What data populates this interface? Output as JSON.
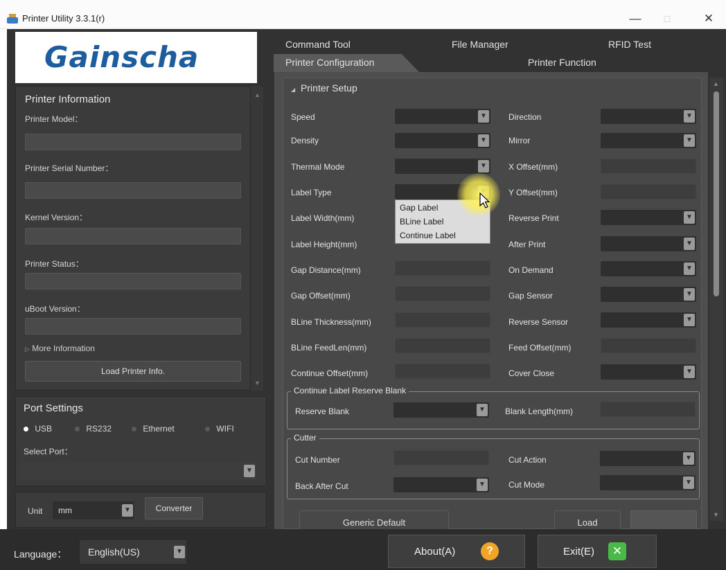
{
  "window": {
    "title": "Printer Utility 3.3.1(r)",
    "minimize": "—",
    "maximize": "□",
    "close": "✕"
  },
  "logo": {
    "text": "Gainscha"
  },
  "printer_info": {
    "title": "Printer Information",
    "model_label": "Printer Model：",
    "serial_label": "Printer Serial Number：",
    "kernel_label": "Kernel Version：",
    "status_label": "Printer Status：",
    "uboot_label": "uBoot Version：",
    "more": "More Information",
    "load_button": "Load Printer Info."
  },
  "port_settings": {
    "title": "Port Settings",
    "options": [
      "USB",
      "RS232",
      "Ethernet",
      "WIFI"
    ],
    "selected": "USB",
    "select_port_label": "Select Port："
  },
  "unit": {
    "label": "Unit",
    "value": "mm",
    "converter": "Converter"
  },
  "tabs": {
    "row1": [
      "Command Tool",
      "File Manager",
      "RFID Test"
    ],
    "row2": [
      "Printer Configuration",
      "Printer Function"
    ],
    "active": "Printer Configuration"
  },
  "printer_setup": {
    "title": "Printer Setup",
    "left": [
      "Speed",
      "Density",
      "Thermal Mode",
      "Label Type",
      "Label Width(mm)",
      "Label Height(mm)",
      "Gap Distance(mm)",
      "Gap Offset(mm)",
      "BLine Thickness(mm)",
      "BLine FeedLen(mm)",
      "Continue Offset(mm)"
    ],
    "right": [
      "Direction",
      "Mirror",
      "X Offset(mm)",
      "Y Offset(mm)",
      "Reverse Print",
      "After Print",
      "On Demand",
      "Gap Sensor",
      "Reverse Sensor",
      "Feed Offset(mm)",
      "Cover Close"
    ],
    "dropdown_options": [
      "Gap Label",
      "BLine Label",
      "Continue Label"
    ]
  },
  "continue_blank": {
    "title": "Continue Label Reserve Blank",
    "reserve_label": "Reserve Blank",
    "length_label": "Blank Length(mm)"
  },
  "cutter": {
    "title": "Cutter",
    "cut_number": "Cut Number",
    "cut_action": "Cut Action",
    "back_after_cut": "Back After Cut",
    "cut_mode": "Cut Mode"
  },
  "bottom_buttons": {
    "generic_default": "Generic Default",
    "load": "Load"
  },
  "footer": {
    "language_label": "Language：",
    "language_value": "English(US)",
    "about": "About(A)",
    "exit": "Exit(E)"
  }
}
